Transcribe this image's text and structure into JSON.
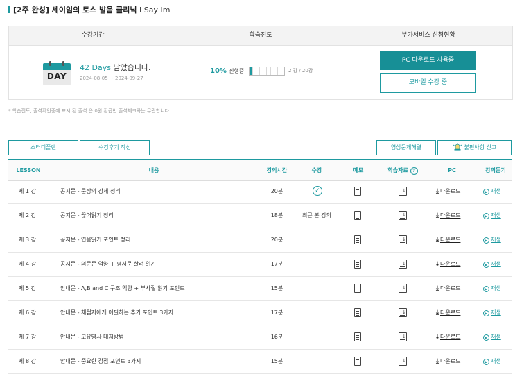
{
  "course": {
    "title_bracket": "[2주 완성] 세이임의 토스 발음 클리닉",
    "title_sub": "I Say Im"
  },
  "summary": {
    "col_period": "수강기간",
    "col_progress": "학습진도",
    "col_addon": "부가서비스 신청현황",
    "calendar_text": "DAY",
    "days_left": "42 Days",
    "days_suffix": "남았습니다.",
    "period_range": "2024-08-05 ~ 2024-09-27",
    "progress_percent": "10%",
    "progress_status": "진행중",
    "progress_fraction": 0.1,
    "progress_count": "2 강 / 20강",
    "pc_button": "PC 다운로드 사용중",
    "mobile_button": "모바일 수강 중"
  },
  "note": "* 학습진도, 출석확인중에 표시 된 출석 은 0원 환급반 출석체크와는 무관합니다.",
  "actions": {
    "study_plan": "스터디플랜",
    "review": "수강후기 작성",
    "video_issue": "영상문제해결",
    "report": "불편사항 신고"
  },
  "table": {
    "headers": {
      "lesson": "LESSON",
      "content": "내용",
      "time": "강의시간",
      "status": "수강",
      "memo": "메모",
      "material": "학습자료",
      "pc": "PC",
      "play": "강의듣기"
    },
    "download_label": "다운로드",
    "play_label": "재생",
    "rows": [
      {
        "lesson": "제 1 강",
        "title": "공지문 - 문장의 강세 정리",
        "time": "20분",
        "status": ""
      },
      {
        "lesson": "제 2 강",
        "title": "공지문 - 끊어읽기 정리",
        "time": "18분",
        "status": "최근 본 강의"
      },
      {
        "lesson": "제 3 강",
        "title": "공지문 - 연음읽기 포인트 정리",
        "time": "20분",
        "status": ""
      },
      {
        "lesson": "제 4 강",
        "title": "공지문 - 의문문 억양 + 평서문 살려 읽기",
        "time": "17분",
        "status": ""
      },
      {
        "lesson": "제 5 강",
        "title": "안내문 - A,B and C 구조 억양 + 부사절 읽기 포인트",
        "time": "15분",
        "status": ""
      },
      {
        "lesson": "제 6 강",
        "title": "안내문 - 채점자에게 어필하는 추가 포인트 3가지",
        "time": "17분",
        "status": ""
      },
      {
        "lesson": "제 7 강",
        "title": "안내문 - 고유명사 대처방법",
        "time": "16분",
        "status": ""
      },
      {
        "lesson": "제 8 강",
        "title": "안내문 - 중요한 감점 포인트 3가지",
        "time": "15분",
        "status": ""
      }
    ]
  }
}
